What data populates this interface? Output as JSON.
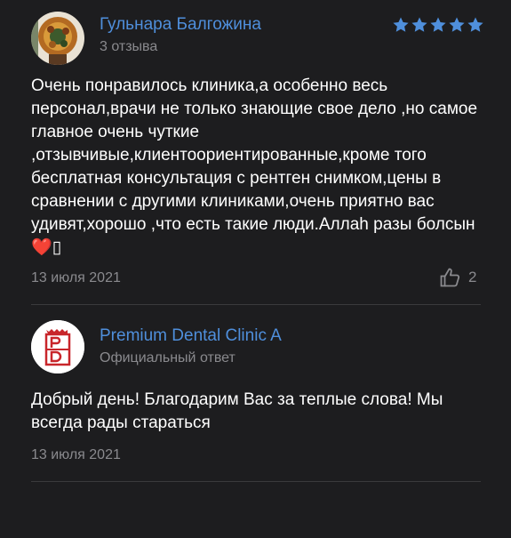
{
  "review": {
    "author_name": "Гульнара Балгожина",
    "author_meta": "3 отзыва",
    "rating": 5,
    "rating_max": 5,
    "star_color": "#4f8fdc",
    "text": "Очень понравилось клиника,а особенно весь персонал,врачи не только знающие свое дело ,но самое главное очень чуткие ,отзывчивые,клиентоориентированные,кроме того бесплатная консультация с рентген снимком,цены в сравнении с другими клиниками,очень приятно вас удивят,хорошо ,что есть такие люди.Аллаh разы болсын",
    "text_emoji": "❤️",
    "text_tail_glyph": "▯",
    "date": "13 июля 2021",
    "likes": "2",
    "like_icon": "thumbs-up-icon"
  },
  "reply": {
    "org_name": "Premium Dental Clinic A",
    "org_meta": "Официальный ответ",
    "logo_letters": "PD",
    "logo_color": "#c8262b",
    "text": "Добрый день! Благодарим Вас за теплые слова! Мы всегда рады стараться",
    "date": "13 июля 2021"
  },
  "colors": {
    "background": "#1d1d1f",
    "link": "#4f8fdc",
    "muted": "#8a8a8e",
    "divider": "#3a3a3c"
  }
}
